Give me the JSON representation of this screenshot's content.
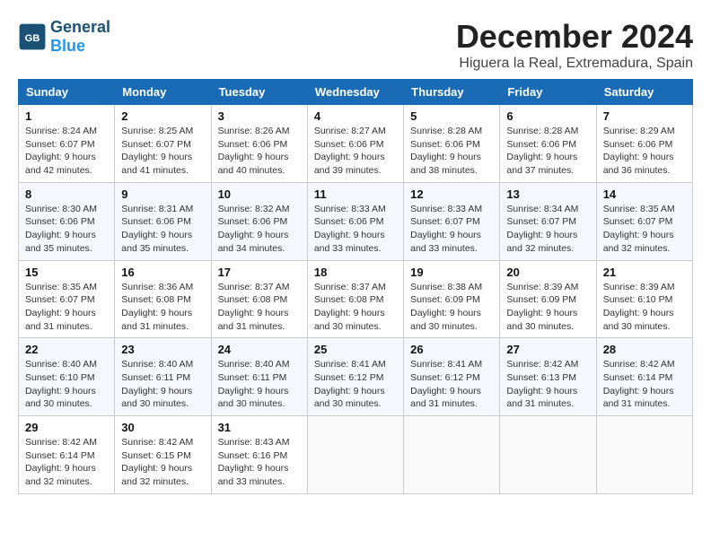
{
  "header": {
    "logo_general": "General",
    "logo_blue": "Blue",
    "month_title": "December 2024",
    "location": "Higuera la Real, Extremadura, Spain"
  },
  "columns": [
    "Sunday",
    "Monday",
    "Tuesday",
    "Wednesday",
    "Thursday",
    "Friday",
    "Saturday"
  ],
  "weeks": [
    [
      {
        "day": "1",
        "sunrise": "Sunrise: 8:24 AM",
        "sunset": "Sunset: 6:07 PM",
        "daylight": "Daylight: 9 hours and 42 minutes."
      },
      {
        "day": "2",
        "sunrise": "Sunrise: 8:25 AM",
        "sunset": "Sunset: 6:07 PM",
        "daylight": "Daylight: 9 hours and 41 minutes."
      },
      {
        "day": "3",
        "sunrise": "Sunrise: 8:26 AM",
        "sunset": "Sunset: 6:06 PM",
        "daylight": "Daylight: 9 hours and 40 minutes."
      },
      {
        "day": "4",
        "sunrise": "Sunrise: 8:27 AM",
        "sunset": "Sunset: 6:06 PM",
        "daylight": "Daylight: 9 hours and 39 minutes."
      },
      {
        "day": "5",
        "sunrise": "Sunrise: 8:28 AM",
        "sunset": "Sunset: 6:06 PM",
        "daylight": "Daylight: 9 hours and 38 minutes."
      },
      {
        "day": "6",
        "sunrise": "Sunrise: 8:28 AM",
        "sunset": "Sunset: 6:06 PM",
        "daylight": "Daylight: 9 hours and 37 minutes."
      },
      {
        "day": "7",
        "sunrise": "Sunrise: 8:29 AM",
        "sunset": "Sunset: 6:06 PM",
        "daylight": "Daylight: 9 hours and 36 minutes."
      }
    ],
    [
      {
        "day": "8",
        "sunrise": "Sunrise: 8:30 AM",
        "sunset": "Sunset: 6:06 PM",
        "daylight": "Daylight: 9 hours and 35 minutes."
      },
      {
        "day": "9",
        "sunrise": "Sunrise: 8:31 AM",
        "sunset": "Sunset: 6:06 PM",
        "daylight": "Daylight: 9 hours and 35 minutes."
      },
      {
        "day": "10",
        "sunrise": "Sunrise: 8:32 AM",
        "sunset": "Sunset: 6:06 PM",
        "daylight": "Daylight: 9 hours and 34 minutes."
      },
      {
        "day": "11",
        "sunrise": "Sunrise: 8:33 AM",
        "sunset": "Sunset: 6:06 PM",
        "daylight": "Daylight: 9 hours and 33 minutes."
      },
      {
        "day": "12",
        "sunrise": "Sunrise: 8:33 AM",
        "sunset": "Sunset: 6:07 PM",
        "daylight": "Daylight: 9 hours and 33 minutes."
      },
      {
        "day": "13",
        "sunrise": "Sunrise: 8:34 AM",
        "sunset": "Sunset: 6:07 PM",
        "daylight": "Daylight: 9 hours and 32 minutes."
      },
      {
        "day": "14",
        "sunrise": "Sunrise: 8:35 AM",
        "sunset": "Sunset: 6:07 PM",
        "daylight": "Daylight: 9 hours and 32 minutes."
      }
    ],
    [
      {
        "day": "15",
        "sunrise": "Sunrise: 8:35 AM",
        "sunset": "Sunset: 6:07 PM",
        "daylight": "Daylight: 9 hours and 31 minutes."
      },
      {
        "day": "16",
        "sunrise": "Sunrise: 8:36 AM",
        "sunset": "Sunset: 6:08 PM",
        "daylight": "Daylight: 9 hours and 31 minutes."
      },
      {
        "day": "17",
        "sunrise": "Sunrise: 8:37 AM",
        "sunset": "Sunset: 6:08 PM",
        "daylight": "Daylight: 9 hours and 31 minutes."
      },
      {
        "day": "18",
        "sunrise": "Sunrise: 8:37 AM",
        "sunset": "Sunset: 6:08 PM",
        "daylight": "Daylight: 9 hours and 30 minutes."
      },
      {
        "day": "19",
        "sunrise": "Sunrise: 8:38 AM",
        "sunset": "Sunset: 6:09 PM",
        "daylight": "Daylight: 9 hours and 30 minutes."
      },
      {
        "day": "20",
        "sunrise": "Sunrise: 8:39 AM",
        "sunset": "Sunset: 6:09 PM",
        "daylight": "Daylight: 9 hours and 30 minutes."
      },
      {
        "day": "21",
        "sunrise": "Sunrise: 8:39 AM",
        "sunset": "Sunset: 6:10 PM",
        "daylight": "Daylight: 9 hours and 30 minutes."
      }
    ],
    [
      {
        "day": "22",
        "sunrise": "Sunrise: 8:40 AM",
        "sunset": "Sunset: 6:10 PM",
        "daylight": "Daylight: 9 hours and 30 minutes."
      },
      {
        "day": "23",
        "sunrise": "Sunrise: 8:40 AM",
        "sunset": "Sunset: 6:11 PM",
        "daylight": "Daylight: 9 hours and 30 minutes."
      },
      {
        "day": "24",
        "sunrise": "Sunrise: 8:40 AM",
        "sunset": "Sunset: 6:11 PM",
        "daylight": "Daylight: 9 hours and 30 minutes."
      },
      {
        "day": "25",
        "sunrise": "Sunrise: 8:41 AM",
        "sunset": "Sunset: 6:12 PM",
        "daylight": "Daylight: 9 hours and 30 minutes."
      },
      {
        "day": "26",
        "sunrise": "Sunrise: 8:41 AM",
        "sunset": "Sunset: 6:12 PM",
        "daylight": "Daylight: 9 hours and 31 minutes."
      },
      {
        "day": "27",
        "sunrise": "Sunrise: 8:42 AM",
        "sunset": "Sunset: 6:13 PM",
        "daylight": "Daylight: 9 hours and 31 minutes."
      },
      {
        "day": "28",
        "sunrise": "Sunrise: 8:42 AM",
        "sunset": "Sunset: 6:14 PM",
        "daylight": "Daylight: 9 hours and 31 minutes."
      }
    ],
    [
      {
        "day": "29",
        "sunrise": "Sunrise: 8:42 AM",
        "sunset": "Sunset: 6:14 PM",
        "daylight": "Daylight: 9 hours and 32 minutes."
      },
      {
        "day": "30",
        "sunrise": "Sunrise: 8:42 AM",
        "sunset": "Sunset: 6:15 PM",
        "daylight": "Daylight: 9 hours and 32 minutes."
      },
      {
        "day": "31",
        "sunrise": "Sunrise: 8:43 AM",
        "sunset": "Sunset: 6:16 PM",
        "daylight": "Daylight: 9 hours and 33 minutes."
      },
      null,
      null,
      null,
      null
    ]
  ]
}
